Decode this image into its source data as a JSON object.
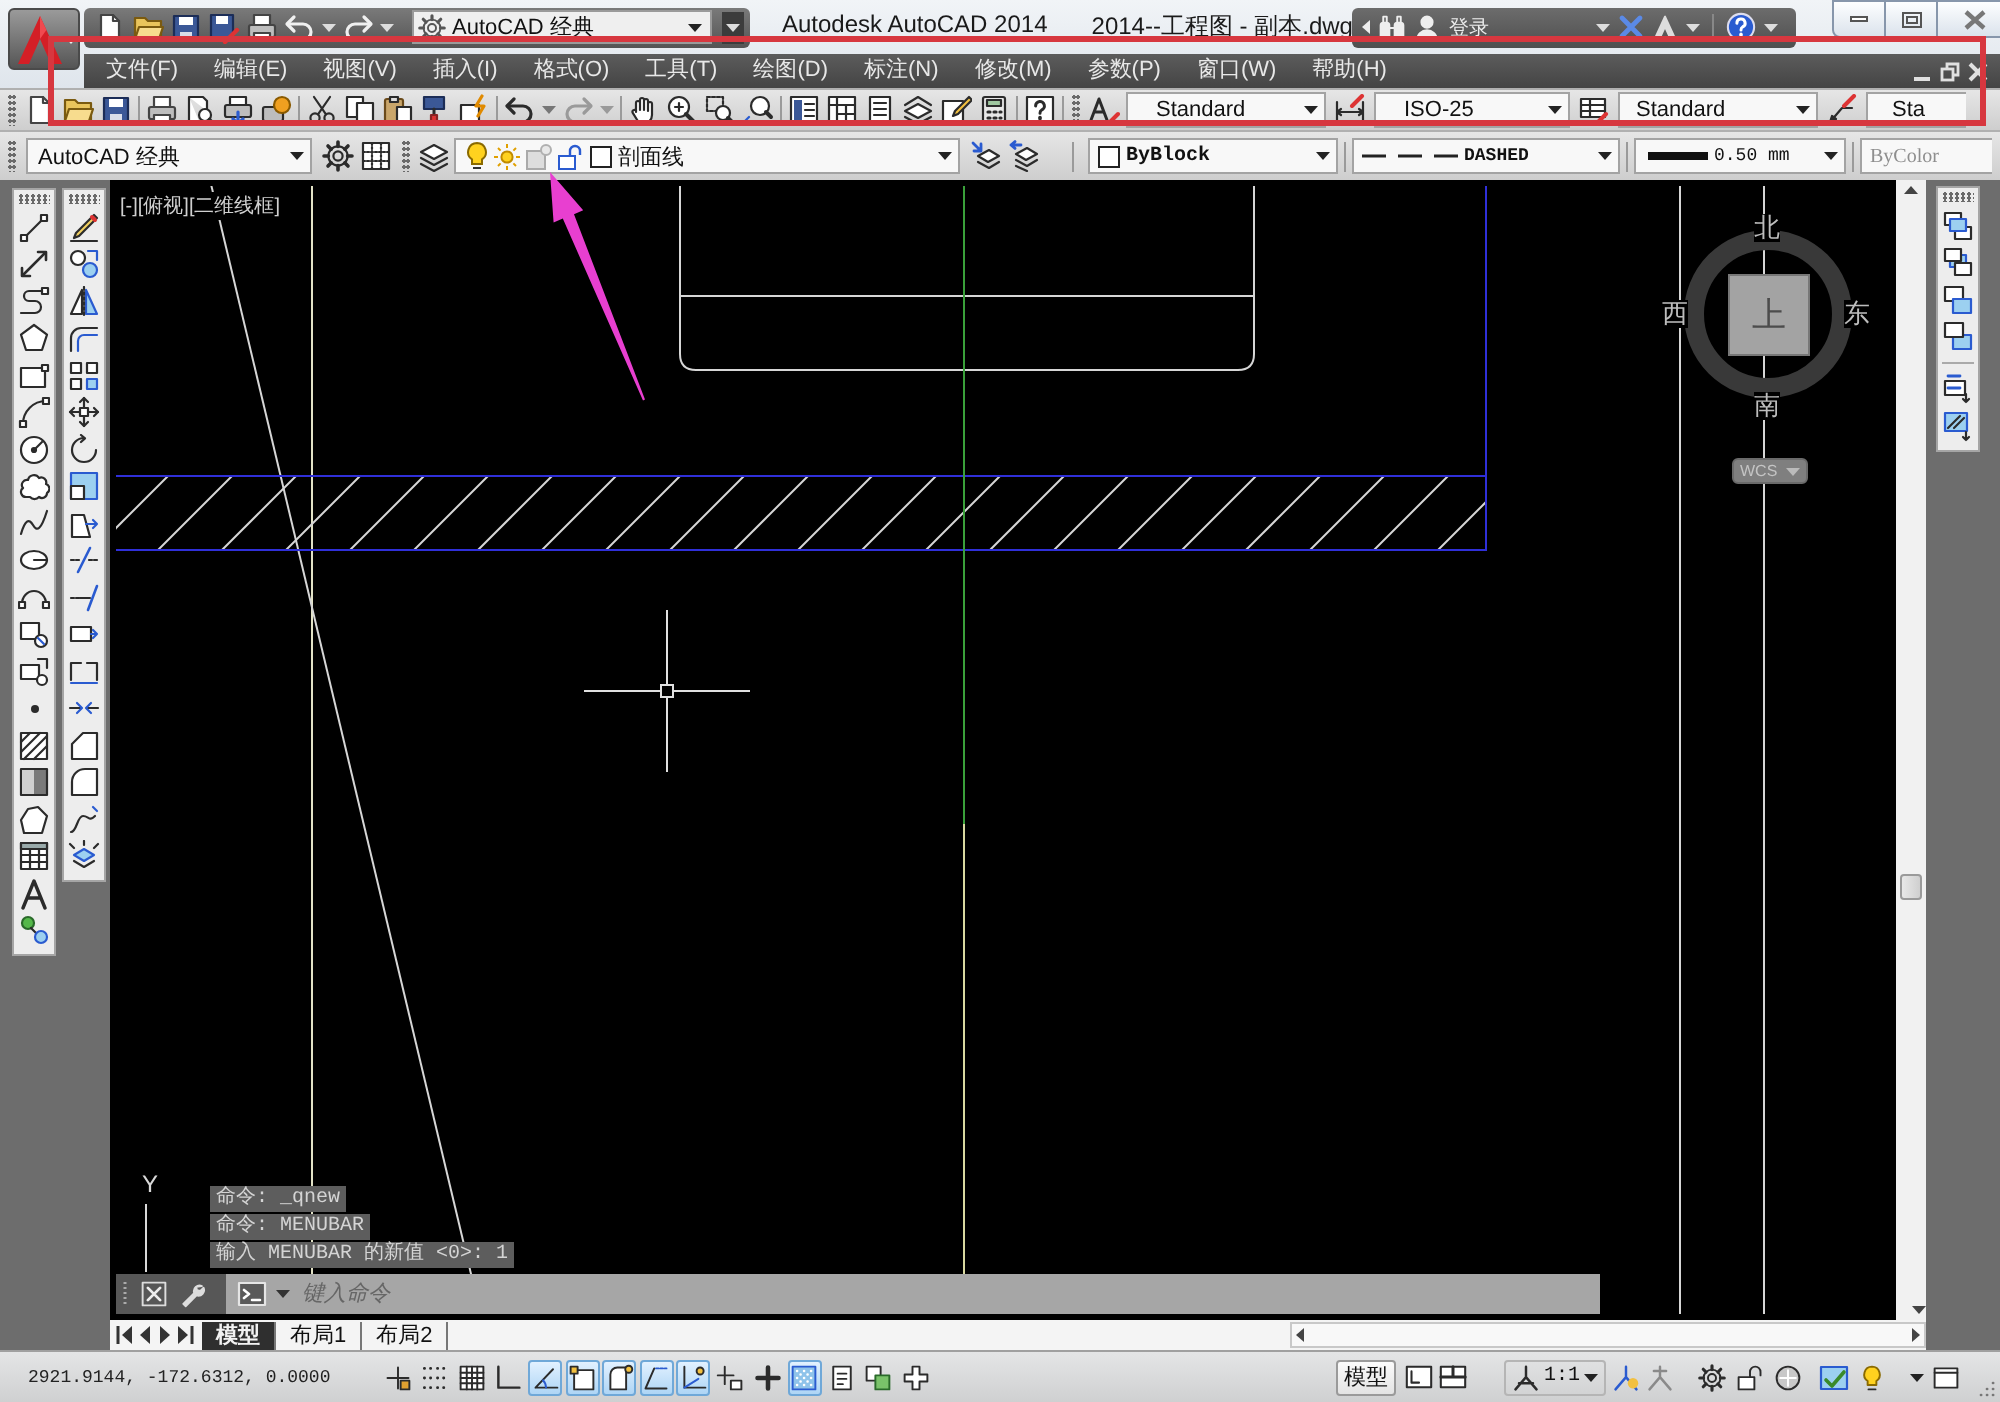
{
  "title_bar": {
    "workspace": "AutoCAD 经典",
    "app_title": "Autodesk AutoCAD 2014",
    "file_title": "2014--工程图 - 副本.dwg",
    "sign_in": "登录"
  },
  "menu_bar": [
    "文件(F)",
    "编辑(E)",
    "视图(V)",
    "插入(I)",
    "格式(O)",
    "工具(T)",
    "绘图(D)",
    "标注(N)",
    "修改(M)",
    "参数(P)",
    "窗口(W)",
    "帮助(H)"
  ],
  "styles_toolbar": {
    "text_style": "Standard",
    "dimension_style": "ISO-25",
    "table_style": "Standard",
    "multileader_style": "Sta"
  },
  "properties_toolbar": {
    "workspace": "AutoCAD 经典",
    "layer": {
      "name": "剖面线",
      "on": true,
      "frozen": false,
      "locked": false
    },
    "color_dropdown": "ByBlock",
    "linetype": "DASHED",
    "lineweight": "0.50 mm",
    "plot_style": {
      "value": "ByColor",
      "disabled": true
    }
  },
  "viewport": {
    "label": "[-][俯视][二维线框]",
    "viewcube": {
      "north": "北",
      "west": "西",
      "face": "上",
      "east": "东",
      "south": "南"
    },
    "coordinate_system": "WCS",
    "ucs_axis": "Y"
  },
  "command_history": [
    "命令: _qnew",
    "命令: MENUBAR",
    "输入 MENUBAR 的新值 <0>: 1"
  ],
  "command_line": {
    "placeholder": "键入命令"
  },
  "layout_tabs": [
    {
      "label": "模型",
      "selected": true
    },
    {
      "label": "布局1",
      "selected": false
    },
    {
      "label": "布局2",
      "selected": false
    }
  ],
  "status_bar": {
    "coordinates": "2921.9144, -172.6312, 0.0000",
    "toggles": [
      {
        "kind": "infer",
        "on": false
      },
      {
        "kind": "snap",
        "on": false
      },
      {
        "kind": "grid",
        "on": false
      },
      {
        "kind": "ortho",
        "on": false
      },
      {
        "kind": "polar",
        "on": true
      },
      {
        "kind": "osnap",
        "on": true
      },
      {
        "kind": "osnap3d",
        "on": true
      },
      {
        "kind": "otrack",
        "on": true
      },
      {
        "kind": "ducs",
        "on": true
      },
      {
        "kind": "dyn",
        "on": false
      },
      {
        "kind": "lwt",
        "on": false
      },
      {
        "kind": "transparency",
        "on": true
      },
      {
        "kind": "qp",
        "on": false
      },
      {
        "kind": "sc",
        "on": false
      },
      {
        "kind": "am",
        "on": false
      }
    ],
    "space": "模型",
    "annotation_scale": "1:1"
  }
}
